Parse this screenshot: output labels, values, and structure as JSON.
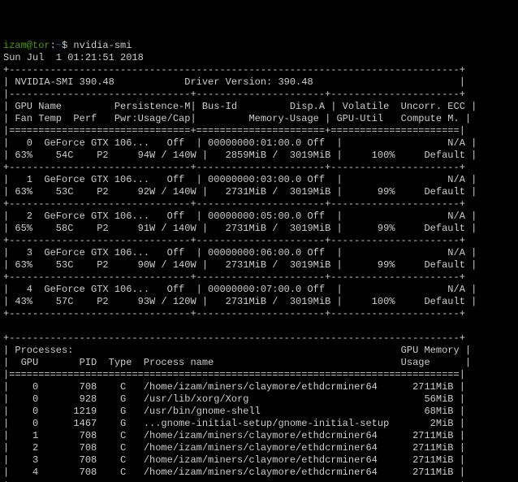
{
  "prompt": {
    "user": "izam@tor",
    "path": "~",
    "sep": "$",
    "cmd": "nvidia-smi"
  },
  "timestamp": "Sun Jul  1 01:21:51 2018",
  "header": {
    "smi": "NVIDIA-SMI 390.48",
    "driver": "Driver Version: 390.48"
  },
  "col_headers": {
    "l1": {
      "gpu": "GPU",
      "name": "Name",
      "persist": "Persistence-M",
      "bus": "Bus-Id",
      "disp": "Disp.A",
      "volatile": "Volatile",
      "ecc": "Uncorr. ECC"
    },
    "l2": {
      "fan": "Fan",
      "temp": "Temp",
      "perf": "Perf",
      "pwr": "Pwr:Usage/Cap",
      "mem": "Memory-Usage",
      "util": "GPU-Util",
      "compute": "Compute M."
    }
  },
  "gpus": [
    {
      "idx": "0",
      "name": "GeForce GTX 106...",
      "persist": "Off",
      "bus": "00000000:01:00.0",
      "disp": "Off",
      "ecc": "N/A",
      "fan": "63%",
      "temp": "54C",
      "perf": "P2",
      "pwr_u": "94W",
      "pwr_c": "140W",
      "mem_u": "2859MiB",
      "mem_t": "3019MiB",
      "util": "100%",
      "compute": "Default"
    },
    {
      "idx": "1",
      "name": "GeForce GTX 106...",
      "persist": "Off",
      "bus": "00000000:03:00.0",
      "disp": "Off",
      "ecc": "N/A",
      "fan": "63%",
      "temp": "53C",
      "perf": "P2",
      "pwr_u": "92W",
      "pwr_c": "140W",
      "mem_u": "2731MiB",
      "mem_t": "3019MiB",
      "util": "99%",
      "compute": "Default"
    },
    {
      "idx": "2",
      "name": "GeForce GTX 106...",
      "persist": "Off",
      "bus": "00000000:05:00.0",
      "disp": "Off",
      "ecc": "N/A",
      "fan": "65%",
      "temp": "58C",
      "perf": "P2",
      "pwr_u": "91W",
      "pwr_c": "140W",
      "mem_u": "2731MiB",
      "mem_t": "3019MiB",
      "util": "99%",
      "compute": "Default"
    },
    {
      "idx": "3",
      "name": "GeForce GTX 106...",
      "persist": "Off",
      "bus": "00000000:06:00.0",
      "disp": "Off",
      "ecc": "N/A",
      "fan": "63%",
      "temp": "53C",
      "perf": "P2",
      "pwr_u": "90W",
      "pwr_c": "140W",
      "mem_u": "2731MiB",
      "mem_t": "3019MiB",
      "util": "99%",
      "compute": "Default"
    },
    {
      "idx": "4",
      "name": "GeForce GTX 106...",
      "persist": "Off",
      "bus": "00000000:07:00.0",
      "disp": "Off",
      "ecc": "N/A",
      "fan": "43%",
      "temp": "57C",
      "perf": "P2",
      "pwr_u": "93W",
      "pwr_c": "120W",
      "mem_u": "2731MiB",
      "mem_t": "3019MiB",
      "util": "100%",
      "compute": "Default"
    }
  ],
  "proc_header": {
    "title": "Processes:",
    "gpu": "GPU",
    "pid": "PID",
    "type": "Type",
    "name": "Process name",
    "mem1": "GPU Memory",
    "mem2": "Usage"
  },
  "processes": [
    {
      "gpu": "0",
      "pid": "708",
      "type": "C",
      "name": "/home/izam/miners/claymore/ethdcrminer64",
      "mem": "2711MiB"
    },
    {
      "gpu": "0",
      "pid": "928",
      "type": "G",
      "name": "/usr/lib/xorg/Xorg",
      "mem": "56MiB"
    },
    {
      "gpu": "0",
      "pid": "1219",
      "type": "G",
      "name": "/usr/bin/gnome-shell",
      "mem": "68MiB"
    },
    {
      "gpu": "0",
      "pid": "1467",
      "type": "G",
      "name": "...gnome-initial-setup/gnome-initial-setup",
      "mem": "2MiB"
    },
    {
      "gpu": "1",
      "pid": "708",
      "type": "C",
      "name": "/home/izam/miners/claymore/ethdcrminer64",
      "mem": "2711MiB"
    },
    {
      "gpu": "2",
      "pid": "708",
      "type": "C",
      "name": "/home/izam/miners/claymore/ethdcrminer64",
      "mem": "2711MiB"
    },
    {
      "gpu": "3",
      "pid": "708",
      "type": "C",
      "name": "/home/izam/miners/claymore/ethdcrminer64",
      "mem": "2711MiB"
    },
    {
      "gpu": "4",
      "pid": "708",
      "type": "C",
      "name": "/home/izam/miners/claymore/ethdcrminer64",
      "mem": "2711MiB"
    }
  ]
}
